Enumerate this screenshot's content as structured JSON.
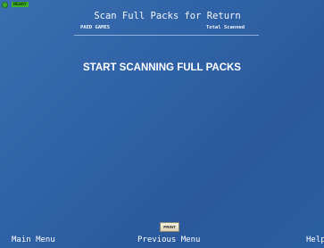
{
  "status": {
    "badge": "READY",
    "indicator_color": "#3fae2a"
  },
  "header": {
    "title": "Scan Full Packs for Return",
    "subtitle_left": "PAED GAMES",
    "subtitle_right": "Total Scanned"
  },
  "main": {
    "message": "START SCANNING FULL PACKS"
  },
  "actions": {
    "print_label": "PRINT"
  },
  "footer": {
    "main_menu": "Main Menu",
    "previous_menu": "Previous Menu",
    "help": "Help"
  },
  "colors": {
    "background": "#2f62a6",
    "ready_green": "#3fae2a",
    "print_button": "#efe8cf"
  }
}
